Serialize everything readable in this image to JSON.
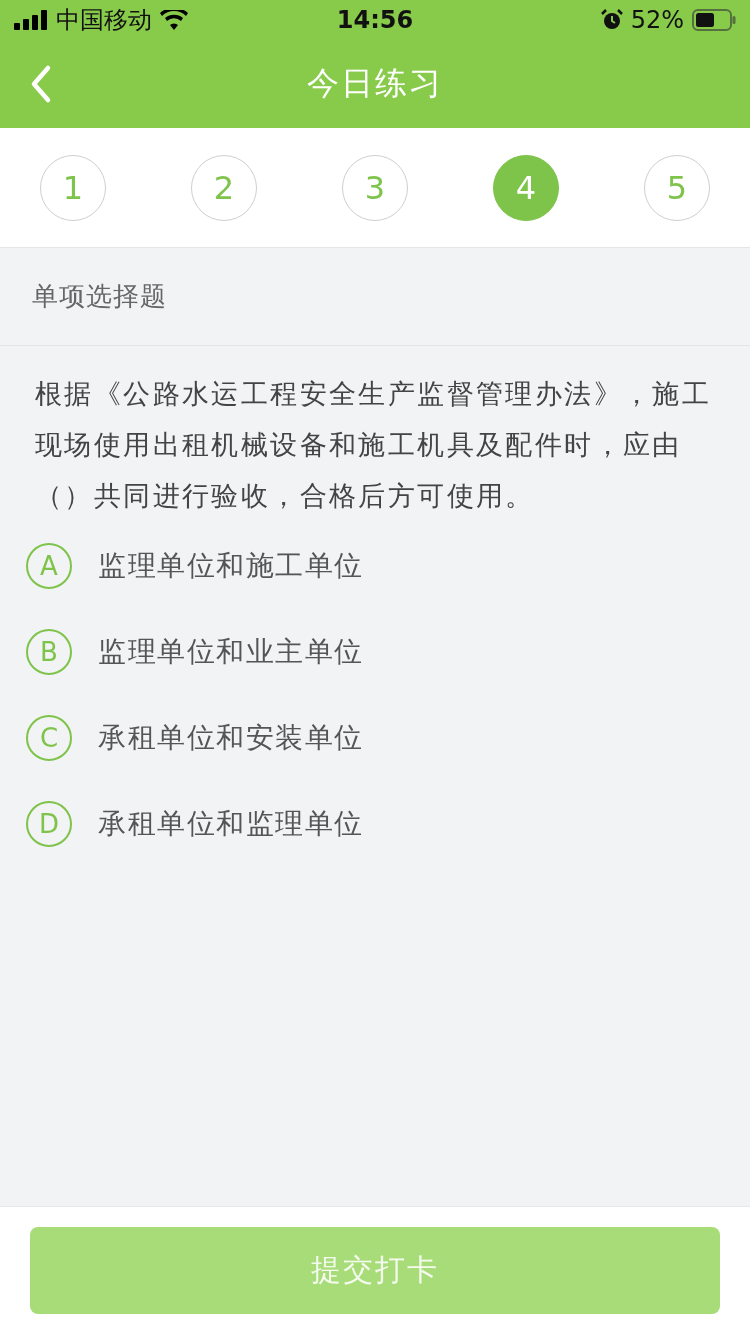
{
  "status_bar": {
    "carrier": "中国移动",
    "time": "14:56",
    "battery": "52%"
  },
  "nav": {
    "title": "今日练习"
  },
  "question_tabs": [
    {
      "label": "1",
      "selected": false
    },
    {
      "label": "2",
      "selected": false
    },
    {
      "label": "3",
      "selected": false
    },
    {
      "label": "4",
      "selected": true
    },
    {
      "label": "5",
      "selected": false
    }
  ],
  "question": {
    "type": "单项选择题",
    "text": "根据《公路水运工程安全生产监督管理办法》，施工现场使用出租机械设备和施工机具及配件时，应由（）共同进行验收，合格后方可使用。",
    "options": [
      {
        "letter": "A",
        "text": "监理单位和施工单位",
        "selected": false
      },
      {
        "letter": "B",
        "text": "监理单位和业主单位",
        "selected": false
      },
      {
        "letter": "C",
        "text": "承租单位和安装单位",
        "selected": false
      },
      {
        "letter": "D",
        "text": "承租单位和监理单位",
        "selected": false
      }
    ]
  },
  "submit": {
    "label": "提交打卡",
    "disabled": true
  }
}
